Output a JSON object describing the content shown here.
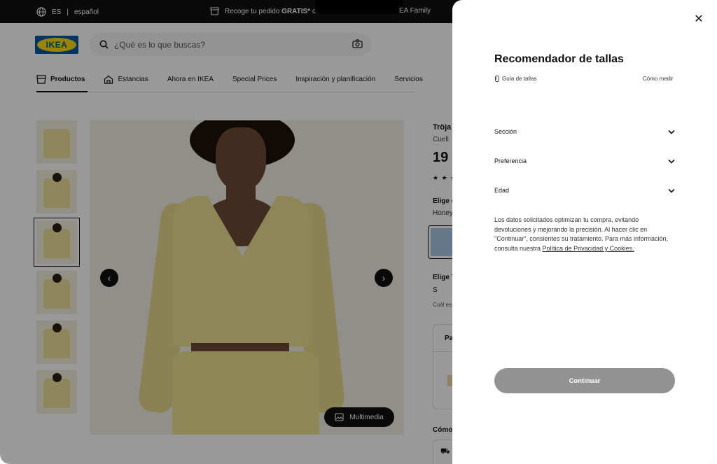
{
  "topbar": {
    "lang_code": "ES",
    "lang_name": "español",
    "pickup_prefix": "Recoge tu pedido ",
    "pickup_bold": "GRATIS*",
    "pickup_suffix": " co",
    "family": "EA Family"
  },
  "header": {
    "logo_text": "IKEA",
    "search_placeholder": "¿Qué es lo que buscas?"
  },
  "nav": {
    "items": [
      {
        "label": "Productos"
      },
      {
        "label": "Estancias"
      },
      {
        "label": "Ahora en IKEA"
      },
      {
        "label": "Special Prices"
      },
      {
        "label": "Inspiración y planificación"
      },
      {
        "label": "Servicios"
      }
    ]
  },
  "gallery": {
    "media_label": "Multimedia",
    "thumbnail_count": 6,
    "selected_index": 2
  },
  "product": {
    "name": "Tröja",
    "desc": "Cuell",
    "price": "19",
    "stars": "★ ★ ★",
    "color_title": "Elige c",
    "color_value": "Honey",
    "size_title": "Elige T",
    "size_value": "S",
    "size_help": "Cuál es",
    "box_label": "Pa",
    "como_label": "Cómo"
  },
  "panel": {
    "title": "Recomendador de tallas",
    "guide_label": "Guía de tallas",
    "measure_label": "Cómo medir",
    "selects": [
      {
        "label": "Sección"
      },
      {
        "label": "Preferencia"
      },
      {
        "label": "Edad"
      }
    ],
    "info_text": "Los datos solicitados optimizan tu compra, evitando devoluciones y mejorando la precisión. Al hacer clic en \"Continuar\", consientes su tratamiento. Para más información, consulta nuestra ",
    "info_link": "Política de Privacidad y Cookies.",
    "continue_label": "Continuar",
    "continue_color": "#929292"
  },
  "colors": {
    "ikea_blue": "#0058a3",
    "ikea_yellow": "#ffdb00",
    "overlay": "rgba(0,0,0,0.40)"
  }
}
